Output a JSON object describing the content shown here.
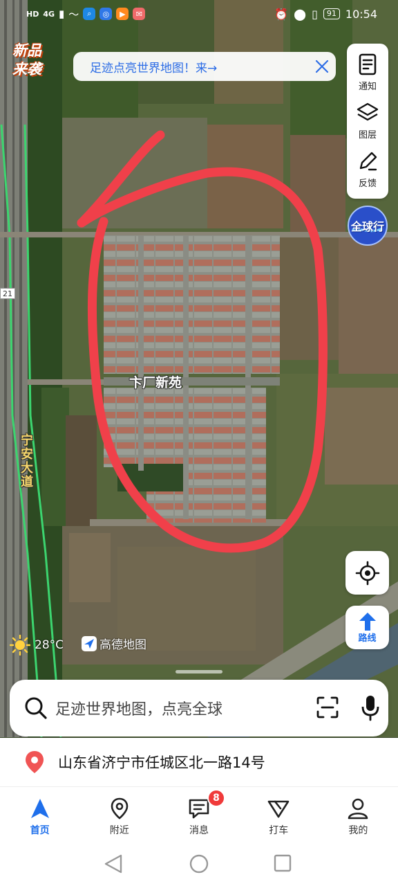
{
  "status_bar": {
    "left_icons": [
      "HD",
      "4G",
      "wifi-icon",
      "signal-icon"
    ],
    "apps": [
      "search-app",
      "browser-app",
      "video-app",
      "mail-app"
    ],
    "right_icons": [
      "alarm-icon",
      "location-icon",
      "vibrate-icon"
    ],
    "battery": "91",
    "time": "10:54"
  },
  "promo_badge": {
    "line1": "新品",
    "line2": "来袭"
  },
  "banner": {
    "text": "足迹点亮世界地图！来→"
  },
  "toolbox": {
    "items": [
      {
        "label": "通知",
        "icon": "notice-icon"
      },
      {
        "label": "图层",
        "icon": "layers-icon"
      },
      {
        "label": "反馈",
        "icon": "feedback-icon"
      }
    ]
  },
  "globe_button": {
    "label": "全球行"
  },
  "map": {
    "poi_label": "卞厂新苑",
    "road_label": "宁安大道",
    "road_number": "21"
  },
  "weather": {
    "temperature": "28°C",
    "icon": "sun-icon"
  },
  "provider": {
    "name": "高德地图"
  },
  "route_button": {
    "label": "路线"
  },
  "search": {
    "placeholder": "足迹世界地图，点亮全球"
  },
  "current_address": "山东省济宁市任城区北一路14号",
  "bottom_nav": {
    "items": [
      {
        "label": "首页",
        "icon": "home-navigation-icon",
        "active": true
      },
      {
        "label": "附近",
        "icon": "nearby-pin-icon"
      },
      {
        "label": "消息",
        "icon": "message-icon",
        "badge": "8"
      },
      {
        "label": "打车",
        "icon": "taxi-icon"
      },
      {
        "label": "我的",
        "icon": "profile-icon"
      }
    ]
  },
  "colors": {
    "accent": "#1f6feb",
    "annotation": "#f0404a",
    "badge": "#f03a3a",
    "road_highlight": "#3cd56f"
  }
}
